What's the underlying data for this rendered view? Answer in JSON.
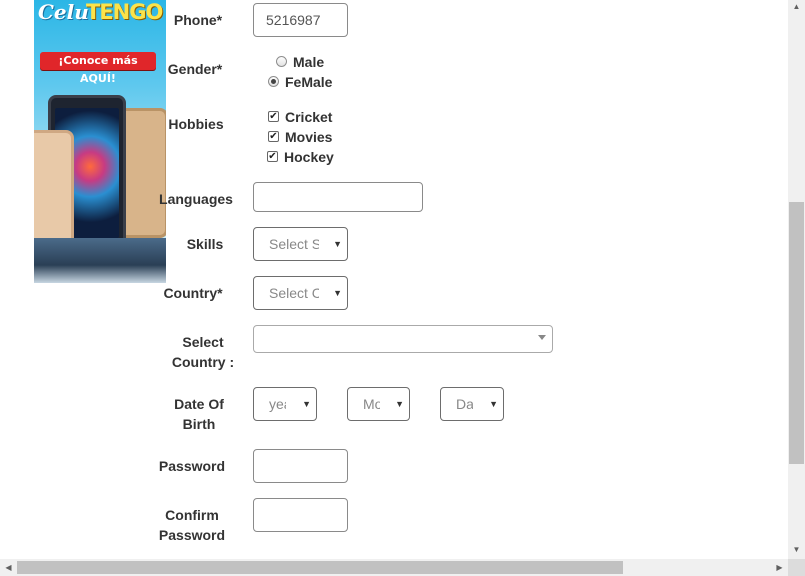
{
  "ad": {
    "brand_part1": "Celu",
    "brand_part2": "TENGO",
    "cta": "¡Conoce más AQUÍ!"
  },
  "form": {
    "phone": {
      "label": "Phone*",
      "value": "5216987"
    },
    "gender": {
      "label": "Gender*",
      "options": [
        "Male",
        "FeMale"
      ],
      "selected": "FeMale"
    },
    "hobbies": {
      "label": "Hobbies",
      "options": [
        "Cricket",
        "Movies",
        "Hockey"
      ],
      "checked": [
        true,
        true,
        true
      ]
    },
    "languages": {
      "label": "Languages",
      "value": ""
    },
    "skills": {
      "label": "Skills",
      "display": "Select Skills"
    },
    "country": {
      "label": "Country*",
      "display": "Select Country"
    },
    "select_country": {
      "label_line1": "Select",
      "label_line2": "Country :",
      "value": ""
    },
    "dob": {
      "label_line1": "Date Of",
      "label_line2": "Birth",
      "year": "year",
      "month": "Month",
      "day": "Day"
    },
    "password": {
      "label": "Password",
      "value": ""
    },
    "confirm_password": {
      "label_line1": "Confirm",
      "label_line2": "Password",
      "value": ""
    }
  },
  "icons": {
    "select_arrow": "▼",
    "check": "✔",
    "scroll_up": "▲",
    "scroll_down": "▼",
    "scroll_left": "◀",
    "scroll_right": "▶"
  }
}
